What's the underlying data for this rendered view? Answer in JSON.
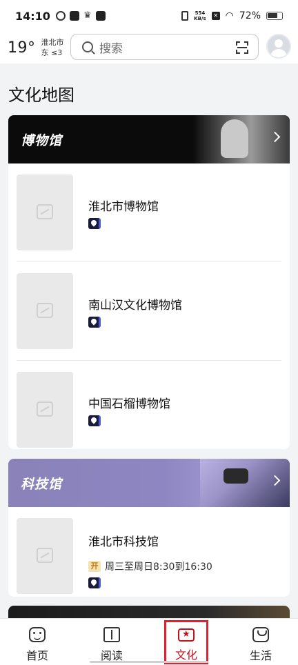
{
  "status_bar": {
    "time": "14:10",
    "net_speed_value": "554",
    "net_speed_unit": "KB/s",
    "battery": "72%"
  },
  "header": {
    "temperature": "19°",
    "city": "淮北市",
    "wind": "东 ≤3",
    "search_placeholder": "搜索"
  },
  "page": {
    "title": "文化地图"
  },
  "sections": [
    {
      "title": "博物馆",
      "venues": [
        {
          "name": "淮北市博物馆"
        },
        {
          "name": "南山汉文化博物馆"
        },
        {
          "name": "中国石榴博物馆"
        }
      ]
    },
    {
      "title": "科技馆",
      "venues": [
        {
          "name": "淮北市科技馆",
          "hours_icon": "开",
          "hours": "周三至周日8:30到16:30"
        }
      ]
    }
  ],
  "bottom_nav": [
    {
      "label": "首页",
      "icon": "home-icon"
    },
    {
      "label": "阅读",
      "icon": "book-icon"
    },
    {
      "label": "文化",
      "icon": "culture-star-icon",
      "active": true
    },
    {
      "label": "生活",
      "icon": "life-bag-icon"
    }
  ],
  "colors": {
    "active": "#c4121c",
    "highlight_box": "#e0202a"
  }
}
